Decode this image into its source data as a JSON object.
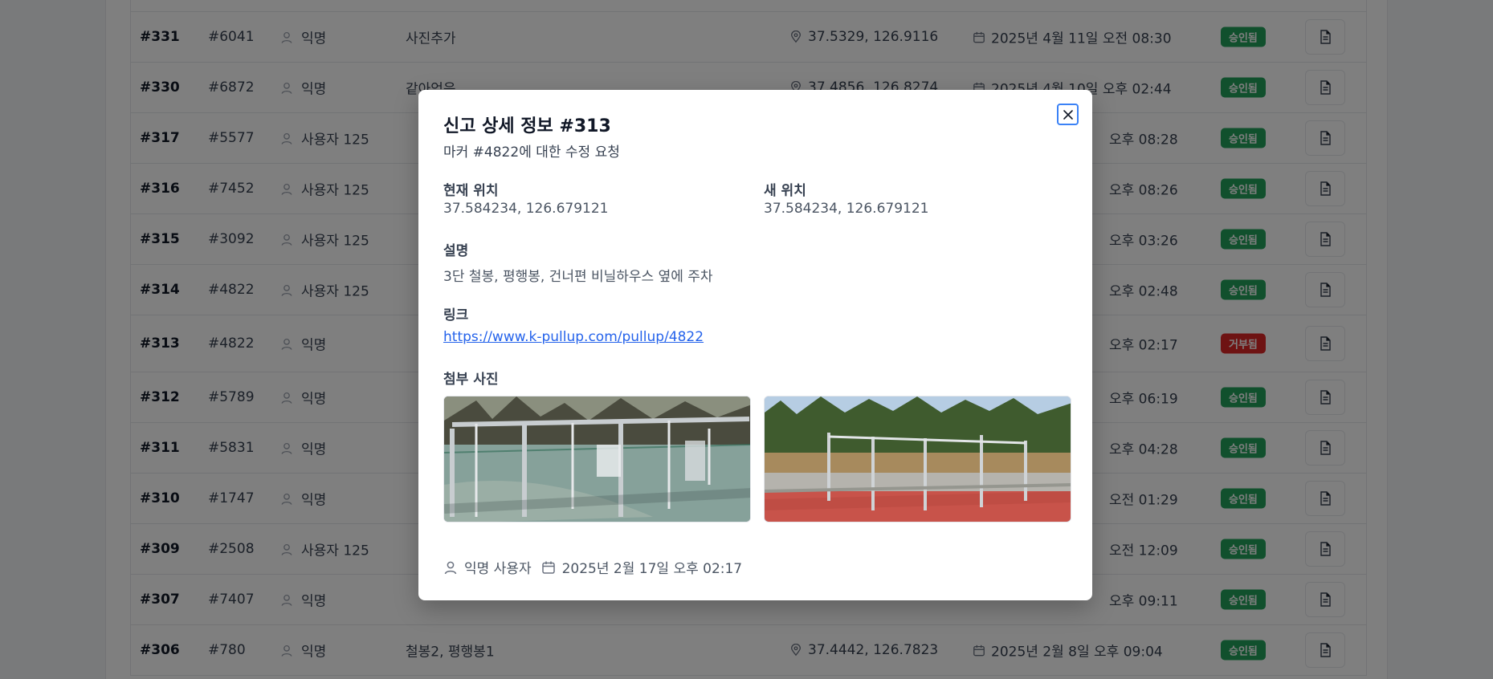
{
  "rows": [
    {
      "id": "#331",
      "marker": "#6041",
      "user": "익명",
      "desc": "사진추가",
      "coord": "37.5329, 126.9116",
      "date": "2025년 4월 11일 오전 08:30",
      "status": "승인됨",
      "status_type": "approved"
    },
    {
      "id": "#330",
      "marker": "#6872",
      "user": "익명",
      "desc": "같아얻음",
      "coord": "37.4856, 126.8274",
      "date": "2025년 4월 10일 오후 02:44",
      "status": "승인됨",
      "status_type": "approved"
    },
    {
      "id": "#317",
      "marker": "#5577",
      "user": "사용자 125",
      "desc": "",
      "coord": "",
      "date": "오후 08:28",
      "status": "승인됨",
      "status_type": "approved"
    },
    {
      "id": "#316",
      "marker": "#7452",
      "user": "사용자 125",
      "desc": "",
      "coord": "",
      "date": "오후 08:26",
      "status": "승인됨",
      "status_type": "approved"
    },
    {
      "id": "#315",
      "marker": "#3092",
      "user": "사용자 125",
      "desc": "",
      "coord": "",
      "date": "오후 03:26",
      "status": "승인됨",
      "status_type": "approved"
    },
    {
      "id": "#314",
      "marker": "#4822",
      "user": "사용자 125",
      "desc": "",
      "coord": "",
      "date": "오후 02:48",
      "status": "승인됨",
      "status_type": "approved"
    },
    {
      "id": "#313",
      "marker": "#4822",
      "user": "익명",
      "desc": "",
      "coord": "",
      "date": "오후 02:17",
      "status": "거부됨",
      "status_type": "rejected"
    },
    {
      "id": "#312",
      "marker": "#5789",
      "user": "익명",
      "desc": "",
      "coord": "",
      "date": "오후 06:19",
      "status": "승인됨",
      "status_type": "approved"
    },
    {
      "id": "#311",
      "marker": "#5831",
      "user": "익명",
      "desc": "",
      "coord": "",
      "date": "오후 04:28",
      "status": "승인됨",
      "status_type": "approved"
    },
    {
      "id": "#310",
      "marker": "#1747",
      "user": "익명",
      "desc": "",
      "coord": "",
      "date": "오전 01:29",
      "status": "승인됨",
      "status_type": "approved"
    },
    {
      "id": "#309",
      "marker": "#2508",
      "user": "사용자 125",
      "desc": "",
      "coord": "",
      "date": "오전 12:09",
      "status": "승인됨",
      "status_type": "approved"
    },
    {
      "id": "#307",
      "marker": "#7407",
      "user": "익명",
      "desc": "",
      "coord": "",
      "date": "오후 09:11",
      "status": "승인됨",
      "status_type": "approved"
    },
    {
      "id": "#306",
      "marker": "#780",
      "user": "익명",
      "desc": "철봉2, 평행봉1",
      "coord": "37.4442, 126.7823",
      "date": "2025년 2월 8일 오후 09:04",
      "status": "승인됨",
      "status_type": "approved"
    }
  ],
  "modal": {
    "title": "신고 상세 정보 #313",
    "subtitle": "마커 #4822에 대한 수정 요청",
    "current_location_label": "현재 위치",
    "current_location_value": "37.584234, 126.679121",
    "new_location_label": "새 위치",
    "new_location_value": "37.584234, 126.679121",
    "description_label": "설명",
    "description_value": "3단 철봉, 평행봉, 건너편 비닐하우스 옆에 주차",
    "link_label": "링크",
    "link_value": "https://www.k-pullup.com/pullup/4822",
    "photos_label": "첨부 사진",
    "author": "익명 사용자",
    "created_at": "2025년 2월 17일 오후 02:17"
  },
  "colors": {
    "approved": "#22a15a",
    "rejected": "#dc2626",
    "link": "#2563eb",
    "focus": "#3b82f6"
  }
}
